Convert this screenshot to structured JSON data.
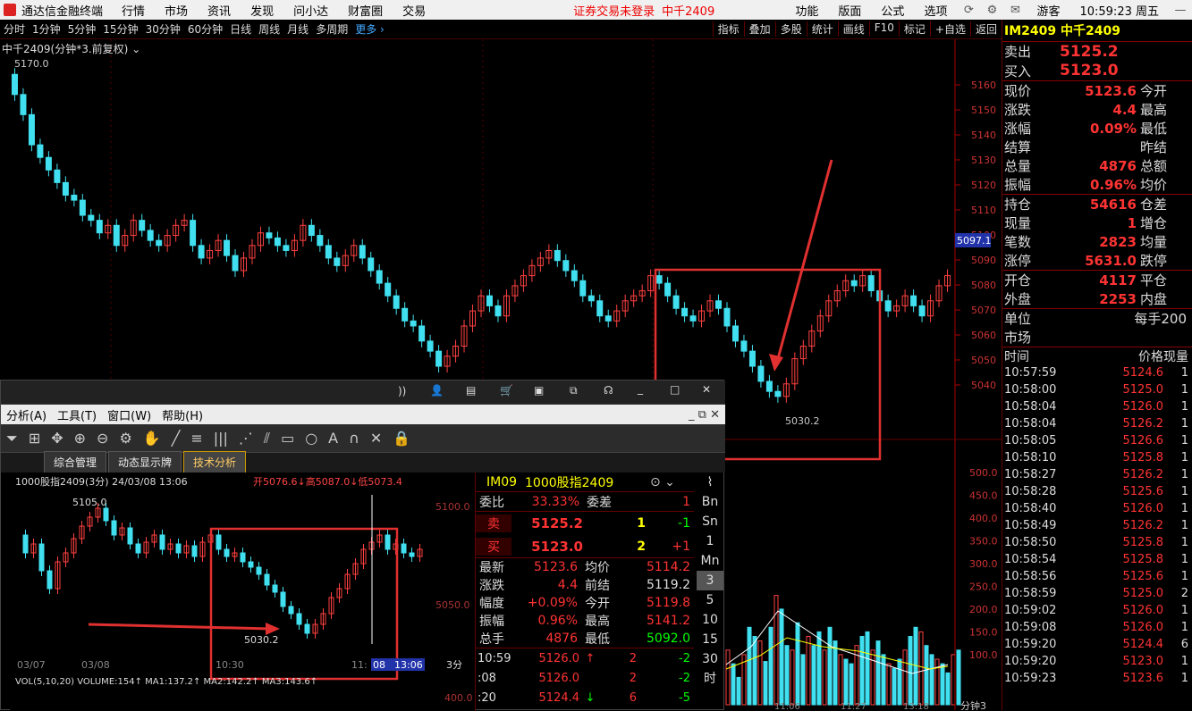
{
  "menubar": {
    "app_title": "通达信金融终端",
    "items": [
      "行情",
      "市场",
      "资讯",
      "发现",
      "问小达",
      "财富圈",
      "交易"
    ],
    "warning": "证券交易未登录",
    "contract": "中千2409",
    "right_items": [
      "功能",
      "版面",
      "公式",
      "选项"
    ],
    "user": "游客",
    "clock": "10:59:23 周五"
  },
  "toolbar": {
    "periods": [
      "分时",
      "1分钟",
      "5分钟",
      "15分钟",
      "30分钟",
      "60分钟",
      "日线",
      "周线",
      "月线",
      "多周期"
    ],
    "more": "更多",
    "tools": [
      "指标",
      "叠加",
      "多股",
      "统计",
      "画线",
      "F10",
      "标记",
      "+自选",
      "返回"
    ]
  },
  "chart": {
    "title": "中千2409(分钟*3.前复权)",
    "high_label": "5170.0",
    "low_label": "5030.2",
    "price_axis": [
      "5160",
      "5150",
      "5140",
      "5130",
      "5120",
      "5110",
      "5100",
      "5090",
      "5080",
      "5070",
      "5060",
      "5050",
      "5040"
    ],
    "current_tag": "5097.1",
    "vol_axis": [
      "500.0",
      "450.0",
      "400.0",
      "350.0",
      "300.0",
      "250.0",
      "200.0",
      "150.0",
      "100.0"
    ],
    "vol_corner_label": "分钟3",
    "time_labels": [
      "11:06",
      "11:27",
      "13:18"
    ],
    "colors": {
      "up": "#ff4040",
      "down": "#40e0f0",
      "box": "#e03030"
    }
  },
  "right_panel": {
    "header": "IM2409 中千2409",
    "sell_label": "卖出",
    "sell_price": "5125.2",
    "buy_label": "买入",
    "buy_price": "5123.0",
    "rows1": [
      {
        "l": "现价",
        "v": "5123.6",
        "r": "今开"
      },
      {
        "l": "涨跌",
        "v": "4.4",
        "r": "最高"
      },
      {
        "l": "涨幅",
        "v": "0.09%",
        "r": "最低"
      },
      {
        "l": "结算",
        "v": "",
        "r": "昨结"
      },
      {
        "l": "总量",
        "v": "4876",
        "r": "总额"
      },
      {
        "l": "振幅",
        "v": "0.96%",
        "r": "均价"
      }
    ],
    "rows2": [
      {
        "l": "持仓",
        "v": "54616",
        "r": "仓差"
      },
      {
        "l": "现量",
        "v": "1",
        "r": "增仓"
      },
      {
        "l": "笔数",
        "v": "2823",
        "r": "均量"
      },
      {
        "l": "涨停",
        "v": "5631.0",
        "r": "跌停"
      }
    ],
    "rows3": [
      {
        "l": "开仓",
        "v": "4117",
        "r": "平仓"
      },
      {
        "l": "外盘",
        "v": "2253",
        "r": "内盘"
      }
    ],
    "unit_label": "单位",
    "unit_value": "每手200",
    "market_label": "市场",
    "ticks_header": {
      "time": "时间",
      "price": "价格",
      "vol": "现量"
    },
    "ticks": [
      {
        "t": "10:57:59",
        "p": "5124.6",
        "v": "1"
      },
      {
        "t": "10:58:00",
        "p": "5125.0",
        "v": "1"
      },
      {
        "t": "10:58:04",
        "p": "5126.0",
        "v": "1"
      },
      {
        "t": "10:58:04",
        "p": "5126.2",
        "v": "1"
      },
      {
        "t": "10:58:05",
        "p": "5126.6",
        "v": "1"
      },
      {
        "t": "10:58:10",
        "p": "5125.8",
        "v": "1"
      },
      {
        "t": "10:58:27",
        "p": "5126.2",
        "v": "1"
      },
      {
        "t": "10:58:28",
        "p": "5125.6",
        "v": "1"
      },
      {
        "t": "10:58:40",
        "p": "5126.0",
        "v": "1"
      },
      {
        "t": "10:58:49",
        "p": "5126.2",
        "v": "1"
      },
      {
        "t": "10:58:50",
        "p": "5125.8",
        "v": "1"
      },
      {
        "t": "10:58:54",
        "p": "5125.8",
        "v": "1"
      },
      {
        "t": "10:58:56",
        "p": "5125.6",
        "v": "1"
      },
      {
        "t": "10:58:59",
        "p": "5125.0",
        "v": "2"
      },
      {
        "t": "10:59:02",
        "p": "5126.0",
        "v": "1"
      },
      {
        "t": "10:59:08",
        "p": "5126.0",
        "v": "1"
      },
      {
        "t": "10:59:20",
        "p": "5124.4",
        "v": "6"
      },
      {
        "t": "10:59:20",
        "p": "5123.0",
        "v": "1"
      },
      {
        "t": "10:59:23",
        "p": "5123.6",
        "v": "1"
      }
    ]
  },
  "window": {
    "menu": [
      "分析(A)",
      "工具(T)",
      "窗口(W)",
      "帮助(H)"
    ],
    "tabs": [
      "综合管理",
      "动态显示牌",
      "技术分析"
    ],
    "chart_title": "1000股指2409(3分) 24/03/08 13:06",
    "ohlc": "开5076.6↓高5087.0↓低5073.4",
    "high_label": "5105.0",
    "low_label": "5030.2",
    "axis": [
      "5100.0",
      "5050.0"
    ],
    "dates": [
      "03/07",
      "03/08",
      "10:30",
      "11:",
      "08",
      "13:06",
      "3分"
    ],
    "vol_text": "VOL(5,10,20) VOLUME:154↑ MA1:137.2↑ MA2:142.2↑ MA3:143.6↑",
    "vol_axis": "400.0",
    "quote": {
      "code": "IM09",
      "name": "1000股指2409",
      "wb_label": "委比",
      "wb_value": "33.33%",
      "wc_label": "委差",
      "wc_value": "1",
      "sell_label": "卖",
      "sell_price": "5125.2",
      "sell_vol": "1",
      "sell_chg": "-1",
      "buy_label": "买",
      "buy_price": "5123.0",
      "buy_vol": "2",
      "buy_chg": "+1",
      "rows": [
        {
          "l": "最新",
          "v": "5123.6",
          "l2": "均价",
          "v2": "5114.2"
        },
        {
          "l": "涨跌",
          "v": "4.4",
          "l2": "前结",
          "v2": "5119.2"
        },
        {
          "l": "幅度",
          "v": "+0.09%",
          "l2": "今开",
          "v2": "5119.8"
        },
        {
          "l": "振幅",
          "v": "0.96%",
          "l2": "最高",
          "v2": "5141.2"
        },
        {
          "l": "总手",
          "v": "4876",
          "l2": "最低",
          "v2": "5092.0"
        }
      ],
      "ticks": [
        {
          "t": "10:59",
          "p": "5126.0",
          "a": "↑",
          "v": "2",
          "c": "-2"
        },
        {
          "t": ":08",
          "p": "5126.0",
          "a": "",
          "v": "2",
          "c": "-2"
        },
        {
          "t": ":20",
          "p": "5124.4",
          "a": "↓",
          "v": "6",
          "c": "-5"
        }
      ]
    },
    "side_buttons": [
      "Bn",
      "Sn",
      "1",
      "Mn",
      "3",
      "5",
      "10",
      "15",
      "30",
      "时"
    ]
  }
}
